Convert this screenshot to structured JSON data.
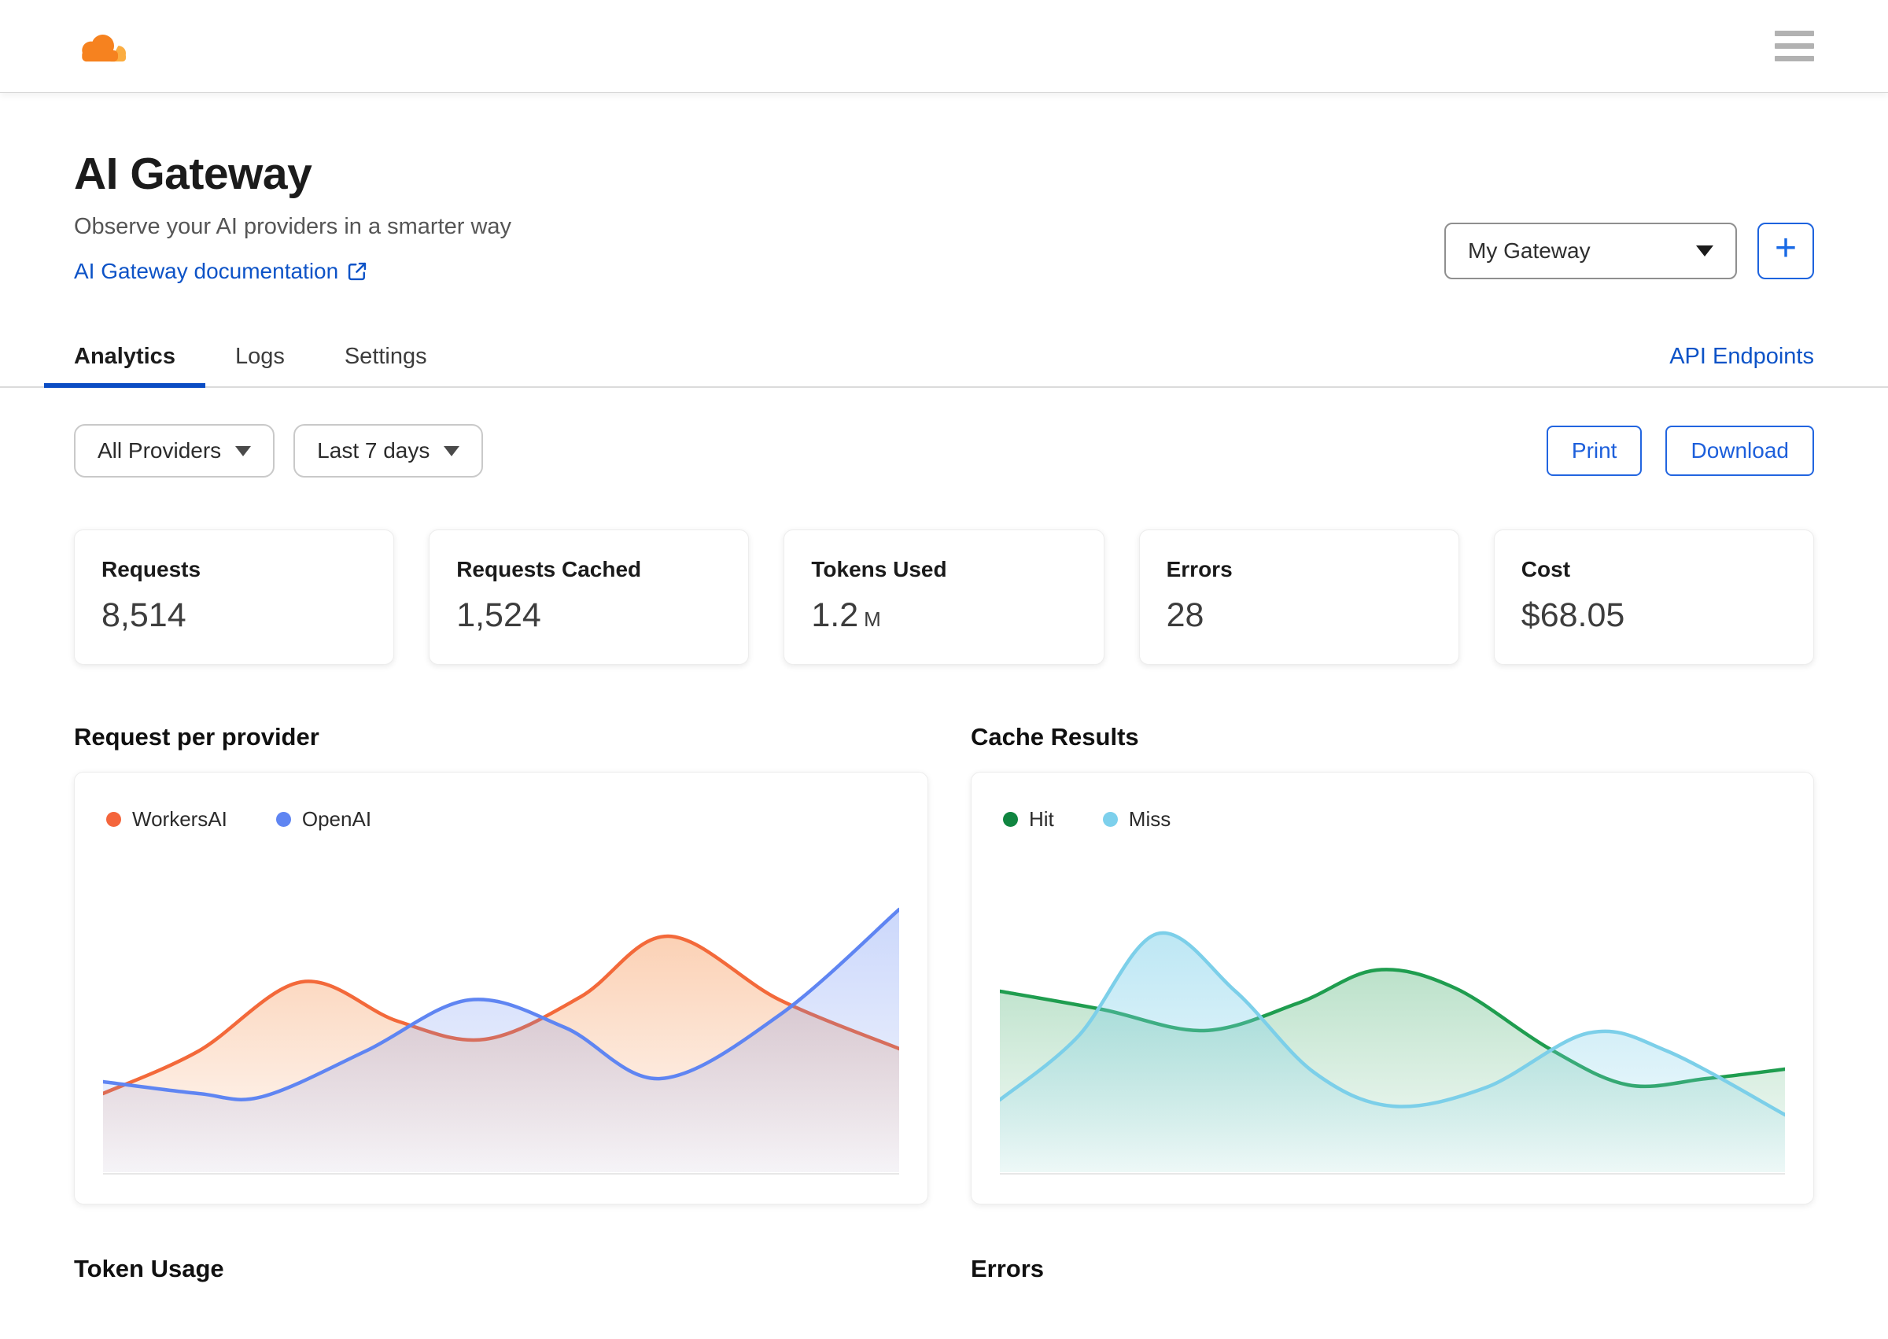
{
  "topbar": {
    "logo_icon": "cloudflare-cloud",
    "menu_icon": "hamburger-menu",
    "logo_orange": "#F6821F",
    "logo_light_orange": "#FBAD41"
  },
  "header": {
    "title": "AI Gateway",
    "subtitle": "Observe your AI providers in a smarter way",
    "doc_link_label": "AI Gateway documentation",
    "doc_link_icon": "external-link",
    "gateway_selected": "My Gateway",
    "add_gateway_label": "+"
  },
  "tabs": {
    "items": [
      {
        "label": "Analytics",
        "active": true
      },
      {
        "label": "Logs",
        "active": false
      },
      {
        "label": "Settings",
        "active": false
      }
    ],
    "right_link": "API Endpoints"
  },
  "filters": {
    "provider_selected": "All Providers",
    "range_selected": "Last 7 days",
    "print_label": "Print",
    "download_label": "Download"
  },
  "stats": [
    {
      "label": "Requests",
      "value": "8,514"
    },
    {
      "label": "Requests Cached",
      "value": "1,524"
    },
    {
      "label": "Tokens Used",
      "value": "1.2",
      "unit": "M"
    },
    {
      "label": "Errors",
      "value": "28"
    },
    {
      "label": "Cost",
      "value": "$68.05"
    }
  ],
  "sections": {
    "requests_chart_title": "Request per provider",
    "cache_chart_title": "Cache Results",
    "token_usage_title": "Token Usage",
    "errors_title": "Errors"
  },
  "colors": {
    "link_blue": "#0D53C7",
    "button_blue": "#1D63DE",
    "tab_underline": "#0B4DC4",
    "baseline_gray": "#E7E7E7"
  },
  "chart_data": [
    {
      "type": "area",
      "title": "Request per provider",
      "time_range": "Last 7 days",
      "axes_labeled": false,
      "grid": false,
      "legend_position": "top-left",
      "ylim": [
        0,
        100
      ],
      "series": [
        {
          "name": "WorkersAI",
          "dot": "#F4653C",
          "color": "#F3693A",
          "fill_top": "rgba(245,140,70,0.40)",
          "fill_bottom": "rgba(245,140,70,0.04)",
          "points": [
            {
              "x": 0,
              "y": 26
            },
            {
              "x": 12,
              "y": 40
            },
            {
              "x": 25,
              "y": 63
            },
            {
              "x": 37,
              "y": 50
            },
            {
              "x": 48,
              "y": 44
            },
            {
              "x": 60,
              "y": 58
            },
            {
              "x": 71,
              "y": 78
            },
            {
              "x": 85,
              "y": 57
            },
            {
              "x": 100,
              "y": 41
            }
          ]
        },
        {
          "name": "OpenAI",
          "dot": "#5F85F2",
          "color": "#5F85F2",
          "fill_top": "rgba(95,133,242,0.32)",
          "fill_bottom": "rgba(95,133,242,0.06)",
          "points": [
            {
              "x": 0,
              "y": 30
            },
            {
              "x": 12,
              "y": 26
            },
            {
              "x": 20,
              "y": 25
            },
            {
              "x": 33,
              "y": 40
            },
            {
              "x": 46,
              "y": 57
            },
            {
              "x": 58,
              "y": 48
            },
            {
              "x": 70,
              "y": 31
            },
            {
              "x": 85,
              "y": 52
            },
            {
              "x": 100,
              "y": 87
            }
          ]
        }
      ]
    },
    {
      "type": "area",
      "title": "Cache Results",
      "time_range": "Last 7 days",
      "axes_labeled": false,
      "grid": false,
      "legend_position": "top-left",
      "ylim": [
        0,
        100
      ],
      "series": [
        {
          "name": "Hit",
          "dot": "#108540",
          "color": "#1F9D4F",
          "fill_top": "rgba(31,157,79,0.30)",
          "fill_bottom": "rgba(31,157,79,0.04)",
          "points": [
            {
              "x": 0,
              "y": 60
            },
            {
              "x": 13,
              "y": 54
            },
            {
              "x": 26,
              "y": 47
            },
            {
              "x": 38,
              "y": 56
            },
            {
              "x": 48,
              "y": 67
            },
            {
              "x": 58,
              "y": 61
            },
            {
              "x": 70,
              "y": 41
            },
            {
              "x": 80,
              "y": 29
            },
            {
              "x": 90,
              "y": 31
            },
            {
              "x": 100,
              "y": 34
            }
          ]
        },
        {
          "name": "Miss",
          "dot": "#7DD0EC",
          "color": "#7CCFE9",
          "fill_top": "rgba(124,207,233,0.50)",
          "fill_bottom": "rgba(124,207,233,0.07)",
          "points": [
            {
              "x": 0,
              "y": 24
            },
            {
              "x": 10,
              "y": 45
            },
            {
              "x": 20,
              "y": 79
            },
            {
              "x": 30,
              "y": 60
            },
            {
              "x": 40,
              "y": 33
            },
            {
              "x": 50,
              "y": 22
            },
            {
              "x": 62,
              "y": 28
            },
            {
              "x": 75,
              "y": 46
            },
            {
              "x": 85,
              "y": 40
            },
            {
              "x": 100,
              "y": 19
            }
          ]
        }
      ]
    }
  ]
}
